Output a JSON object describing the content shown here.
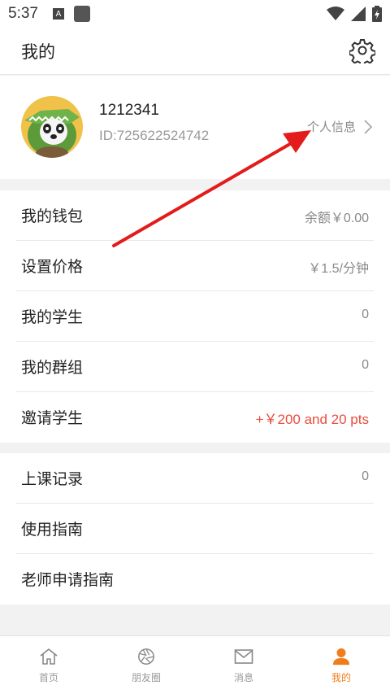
{
  "status": {
    "time": "5:37",
    "notification_letter": "A"
  },
  "header": {
    "title": "我的",
    "settings_icon": "gear-icon"
  },
  "profile": {
    "name": "1212341",
    "id": "ID:725622524742",
    "info_link": "个人信息"
  },
  "section1": [
    {
      "label": "我的钱包",
      "value": "余额￥0.00"
    },
    {
      "label": "设置价格",
      "value": "￥1.5/分钟"
    },
    {
      "label": "我的学生",
      "value": "0"
    },
    {
      "label": "我的群组",
      "value": "0"
    },
    {
      "label": "邀请学生",
      "value": "+￥200 and 20 pts"
    }
  ],
  "section2": [
    {
      "label": "上课记录",
      "value": "0"
    },
    {
      "label": "使用指南",
      "value": ""
    },
    {
      "label": "老师申请指南",
      "value": ""
    }
  ],
  "tabs": [
    {
      "label": "首页",
      "icon": "home-icon"
    },
    {
      "label": "朋友圈",
      "icon": "camera-aperture-icon"
    },
    {
      "label": "消息",
      "icon": "mail-icon"
    },
    {
      "label": "我的",
      "icon": "person-icon"
    }
  ],
  "colors": {
    "accent": "#f07d1c",
    "highlight_red": "#e84c3d",
    "arrow": "#e31b1b"
  }
}
